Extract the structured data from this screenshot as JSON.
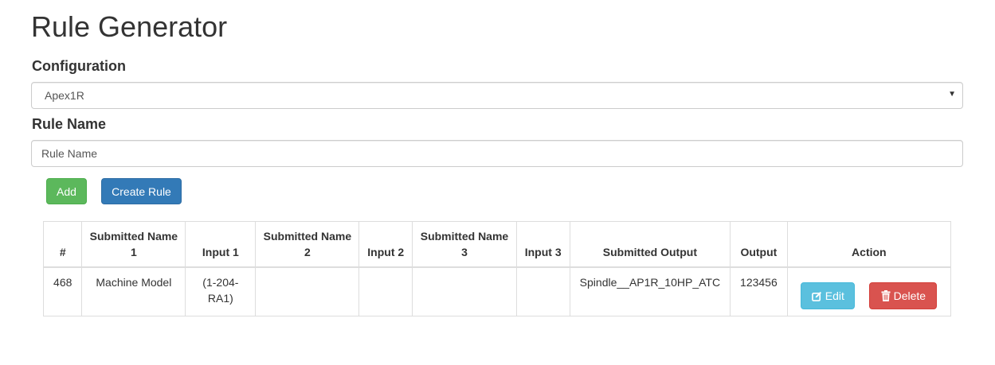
{
  "page": {
    "title": "Rule Generator"
  },
  "configuration": {
    "label": "Configuration",
    "selected": "Apex1R"
  },
  "rule_name": {
    "label": "Rule Name",
    "placeholder": "Rule Name",
    "value": ""
  },
  "buttons": {
    "add": "Add",
    "create_rule": "Create Rule"
  },
  "table": {
    "headers": {
      "num": "#",
      "submitted_name_1": "Submitted Name 1",
      "input_1": "Input 1",
      "submitted_name_2": "Submitted Name 2",
      "input_2": "Input 2",
      "submitted_name_3": "Submitted Name 3",
      "input_3": "Input 3",
      "submitted_output": "Submitted Output",
      "output": "Output",
      "action": "Action"
    },
    "rows": [
      {
        "num": "468",
        "submitted_name_1": "Machine Model",
        "input_1": "(1-204-RA1)",
        "submitted_name_2": "",
        "input_2": "",
        "submitted_name_3": "",
        "input_3": "",
        "submitted_output": "Spindle__AP1R_10HP_ATC",
        "output": "123456",
        "edit_label": "Edit",
        "delete_label": "Delete"
      }
    ]
  },
  "colors": {
    "add_button": "#5cb85c",
    "create_button": "#337ab7",
    "edit_button": "#5bc0de",
    "delete_button": "#d9534f"
  },
  "icons": {
    "select_caret": "caret-down-icon",
    "edit": "edit-icon",
    "delete": "trash-icon"
  }
}
